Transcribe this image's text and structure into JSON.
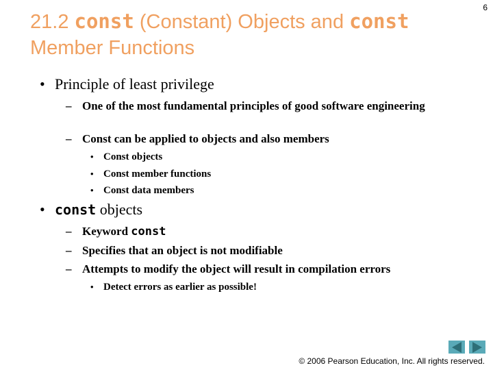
{
  "slide": {
    "number": "6",
    "title": {
      "prefix": "21.2 ",
      "code1": "const",
      "middle": " (Constant) Objects and ",
      "code2": "const",
      "line2": "Member Functions"
    },
    "bullets": [
      {
        "text": "Principle of least privilege",
        "sub": [
          {
            "text": "One of the most fundamental principles of good software engineering"
          },
          {
            "text": "Const can be applied to objects and also members",
            "sub": [
              "Const objects",
              "Const member functions",
              "Const data members"
            ]
          }
        ]
      },
      {
        "code": "const",
        "text": " objects",
        "sub": [
          {
            "text": "Keyword ",
            "code": "const"
          },
          {
            "text": "Specifies that an object is not modifiable"
          },
          {
            "text": "Attempts to modify the object will result in compilation errors",
            "sub": [
              "Detect errors as earlier as possible!"
            ]
          }
        ]
      }
    ],
    "bullet_glyph": "•",
    "dash_glyph": "–",
    "sub_bullet_glyph": "•"
  },
  "navigation": {
    "prev_icon": "triangle-left-icon",
    "next_icon": "triangle-right-icon"
  },
  "footer": {
    "copyright": "© 2006 Pearson Education, Inc.  All rights reserved."
  },
  "colors": {
    "title": "#F0A060",
    "nav_button": "#5AAAB8",
    "nav_arrow": "#2E6F78"
  }
}
